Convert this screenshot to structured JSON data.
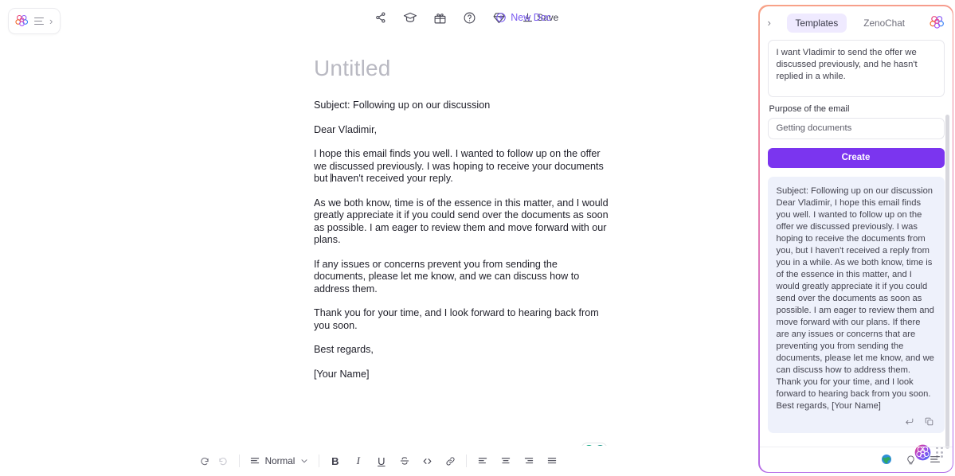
{
  "topbar": {
    "menu_icon": "hamburger-icon",
    "expand_icon": "chevron-right-icon",
    "tools": [
      {
        "name": "share-icon",
        "label": "Share"
      },
      {
        "name": "graduation-cap-icon",
        "label": "Learn"
      },
      {
        "name": "gift-icon",
        "label": "Gift"
      },
      {
        "name": "help-circle-icon",
        "label": "Help"
      },
      {
        "name": "diamond-icon",
        "label": "Premium"
      }
    ],
    "save_label": "Save",
    "new_doc_label": "New Doc"
  },
  "document": {
    "title": "Untitled",
    "paragraphs": [
      "Subject: Following up on our discussion",
      "Dear Vladimir,",
      "I hope this email finds you well. I wanted to follow up on the offer we discussed previously. I was hoping to receive your documents but haven't received your reply.",
      "As we both know, time is of the essence in this matter, and I would greatly appreciate it if you could send over the documents as soon as possible. I am eager to review them and move forward with our plans.",
      "If any issues or concerns prevent you from sending the documents, please let me know, and we can discuss how to address them.",
      "Thank you for your time, and I look forward to hearing back from you soon.",
      "Best regards,",
      "[Your Name]"
    ]
  },
  "editor_toolbar": {
    "undo_label": "Undo",
    "redo_label": "Redo",
    "style_name": "Normal",
    "bold_label": "B",
    "italic_label": "I",
    "underline_label": "U",
    "strikethrough_label": "S",
    "code_label": "<>",
    "link_label": "Link",
    "align_left_label": "Align left",
    "align_center_label": "Align center",
    "align_right_label": "Align right",
    "align_justify_label": "Justify"
  },
  "panel": {
    "collapse_icon": "chevron-right-icon",
    "tabs": [
      {
        "label": "Templates",
        "active": true
      },
      {
        "label": "ZenoChat",
        "active": false
      }
    ],
    "logo_icon": "brain-logo-icon",
    "prompt_value": "I want Vladimir to send the offer we discussed previously, and he hasn't replied in a while.",
    "purpose_label": "Purpose of the email",
    "purpose_value": "Getting documents",
    "create_label": "Create",
    "result_text": "Subject: Following up on our discussion Dear Vladimir, I hope this email finds you well. I wanted to follow up on the offer we discussed previously. I was hoping to receive the documents from you, but I haven't received a reply from you in a while. As we both know, time is of the essence in this matter, and I would greatly appreciate it if you could send over the documents as soon as possible. I am eager to review them and move forward with our plans. If there are any issues or concerns that are preventing you from sending the documents, please let me know, and we can discuss how to address them. Thank you for your time, and I look forward to hearing back from you soon. Best regards, [Your Name]",
    "result_insert_icon": "insert-arrow-icon",
    "result_copy_icon": "copy-icon",
    "avatar_icon": "brain-avatar-icon",
    "drag_handle_icon": "drag-dots-icon",
    "footer_icons": [
      {
        "name": "globe-icon",
        "label": "Language"
      },
      {
        "name": "lightbulb-icon",
        "label": "Tips"
      },
      {
        "name": "list-icon",
        "label": "History"
      }
    ]
  },
  "colors": {
    "accent_purple": "#7b35ef",
    "new_doc_purple": "#7b5cf0",
    "tab_active_bg": "#efeaff",
    "result_card_bg": "#eef1fb",
    "panel_border_top": "#f8a387",
    "panel_border_bottom": "#b06ae8",
    "title_gray": "#b9b9c2"
  },
  "grammar_pill": {
    "dot_a": "grammar-check-icon",
    "dot_b": "grammar-assistant-icon"
  }
}
